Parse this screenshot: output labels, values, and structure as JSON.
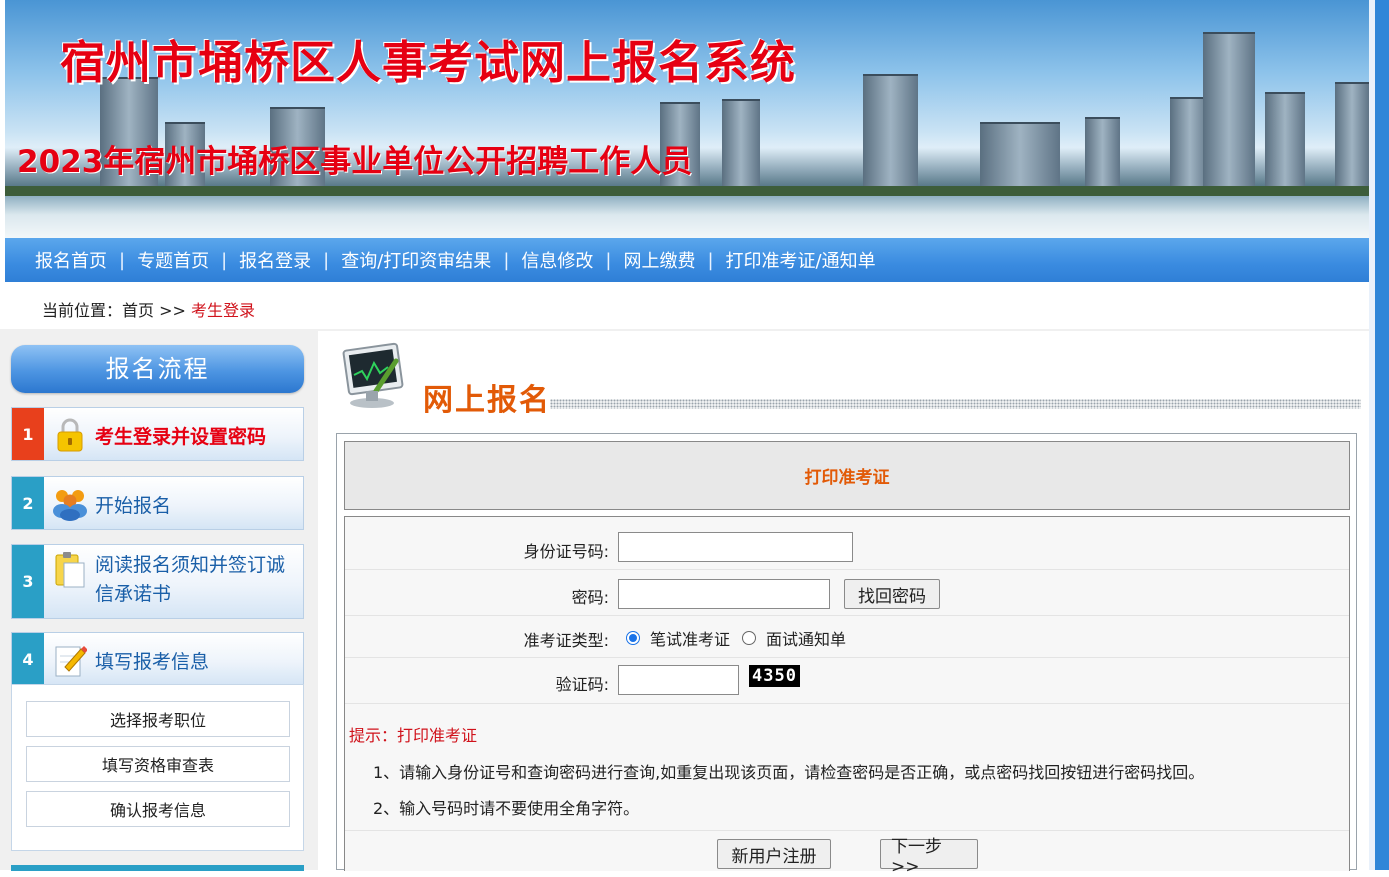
{
  "banner": {
    "title": "宿州市埇桥区人事考试网上报名系统",
    "subtitle": "2023年宿州市埇桥区事业单位公开招聘工作人员"
  },
  "nav": {
    "items": [
      {
        "label": "报名首页"
      },
      {
        "label": "专题首页"
      },
      {
        "label": "报名登录"
      },
      {
        "label": "查询/打印资审结果"
      },
      {
        "label": "信息修改"
      },
      {
        "label": "网上缴费"
      },
      {
        "label": "打印准考证/通知单"
      }
    ],
    "separator": "|"
  },
  "breadcrumb": {
    "prefix": "当前位置：首页 >> ",
    "current": "考生登录"
  },
  "sidebar": {
    "title": "报名流程",
    "steps": [
      {
        "num": "1",
        "label": "考生登录并设置密码",
        "icon": "lock-icon"
      },
      {
        "num": "2",
        "label": "开始报名",
        "icon": "users-icon"
      },
      {
        "num": "3",
        "label_line1": "阅读报名须知并签订诚",
        "label_line2": "信承诺书",
        "icon": "clipboard-icon"
      },
      {
        "num": "4",
        "label": "填写报考信息",
        "icon": "edit-icon"
      }
    ],
    "sub_buttons": [
      "选择报考职位",
      "填写资格审查表",
      "确认报考信息"
    ]
  },
  "main": {
    "section_title": "网上报名",
    "panel_title": "打印准考证",
    "form": {
      "id_label": "身份证号码:",
      "id_value": "",
      "password_label": "密码:",
      "password_value": "",
      "recover_button": "找回密码",
      "type_label": "准考证类型:",
      "type_options": [
        "笔试准考证",
        "面试通知单"
      ],
      "type_selected": "笔试准考证",
      "captcha_label": "验证码:",
      "captcha_value": "",
      "captcha_code": "4350"
    },
    "tips": {
      "title": "提示：打印准考证",
      "lines": [
        "1、请输入身份证号和查询密码进行查询,如重复出现该页面，请检查密码是否正确，或点密码找回按钮进行密码找回。",
        "2、输入号码时请不要使用全角字符。"
      ]
    },
    "buttons": {
      "register": "新用户注册",
      "next": "下一步>>"
    }
  },
  "colors": {
    "title_red": "#e60012",
    "nav_blue": "#3a8be0",
    "accent_orange": "#e25a07",
    "step1_red": "#e8401c",
    "step_teal": "#2a9fc6"
  }
}
